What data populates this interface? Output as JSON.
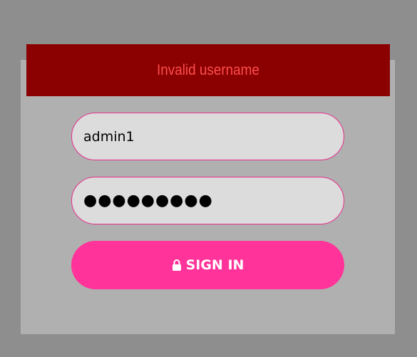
{
  "error": {
    "message": "Invalid username"
  },
  "form": {
    "username_value": "admin1",
    "password_masked": "●●●●●●●●●",
    "signin_label": "SIGN IN",
    "signin_icon": "lock-icon"
  },
  "colors": {
    "background": "#8e8e8e",
    "panel": "#b0b0b0",
    "error_bg": "#8b0000",
    "error_text": "#ff4d4d",
    "field_bg": "#dcdcdc",
    "field_border": "#e5318a",
    "button_bg": "#ff3399",
    "button_text": "#ffffff"
  }
}
